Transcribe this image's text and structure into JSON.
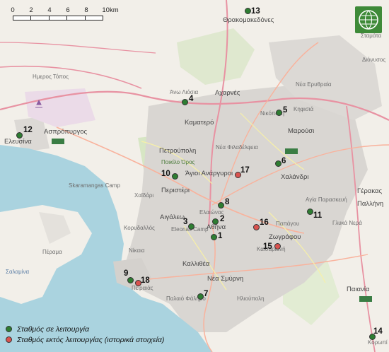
{
  "colors": {
    "active_station": "#2e7d32",
    "inactive_station": "#d9534f",
    "sea": "#aad3df",
    "land": "#f2efe9",
    "urban": "#d6d3d0",
    "motorway": "#e892a2",
    "trunk": "#f9b29c",
    "green_area": "#cde6b8"
  },
  "scale": {
    "ticks": [
      "0",
      "2",
      "4",
      "6",
      "8",
      "10km"
    ]
  },
  "logo": {
    "icon": "meteo-network-logo-icon"
  },
  "legend": {
    "items": [
      {
        "label": "Σταθμός σε λειτουργία",
        "color": "#2e7d32"
      },
      {
        "label": "Σταθμός εκτός λειτουργίας (ιστορικά στοιχεία)",
        "color": "#d9534f"
      }
    ]
  },
  "stations": {
    "s1": {
      "num": "1",
      "status": "active"
    },
    "s2": {
      "num": "2",
      "status": "active"
    },
    "s3": {
      "num": "3",
      "status": "active"
    },
    "s4": {
      "num": "4",
      "status": "active"
    },
    "s5": {
      "num": "5",
      "status": "active"
    },
    "s6": {
      "num": "6",
      "status": "active"
    },
    "s7": {
      "num": "7",
      "status": "active"
    },
    "s8": {
      "num": "8",
      "status": "active"
    },
    "s9": {
      "num": "9",
      "status": "active"
    },
    "s10": {
      "num": "10",
      "status": "active"
    },
    "s11": {
      "num": "11",
      "status": "active"
    },
    "s12": {
      "num": "12",
      "status": "active"
    },
    "s13": {
      "num": "13",
      "status": "active"
    },
    "s14": {
      "num": "14",
      "status": "active"
    },
    "s15": {
      "num": "15",
      "status": "inactive"
    },
    "s16": {
      "num": "16",
      "status": "inactive"
    },
    "s17": {
      "num": "17",
      "status": "inactive"
    },
    "s18": {
      "num": "18",
      "status": "inactive"
    }
  },
  "places": {
    "thrakomakedones": "Θρακομακεδόνες",
    "stamata": "Σταμάτα",
    "dionysos": "Διόνυσος",
    "ymittos_topos": "Ημερος Τόπος",
    "ano_liosia": "Άνω Λιόσια",
    "acharnes": "Αχαρνές",
    "kamatero": "Καματερό",
    "aspropyrgos": "Ασπρόπυργος",
    "elefsina": "Ελευσίνα",
    "nea_erythraia": "Νέα Ερυθραία",
    "kifisia": "Κηφισιά",
    "nikopoli": "Νικόπολη",
    "marousi": "Μαρούσι",
    "petroupoli": "Πετρούπολη",
    "poikilo_oros": "Ποικίλο Όρος",
    "agioi_anargyroi": "Άγιοι Ανάργυροι",
    "peristeri": "Περιστέρι",
    "nea_filadelfeia": "Νέα Φιλαδέλφεια",
    "chalandri": "Χαλάνδρι",
    "gerakas": "Γέρακας",
    "pallini": "Παλλήνη",
    "agia_paraskevi": "Αγία Παρασκευή",
    "skaramangas": "Skaramangas Camp",
    "kaidari": "Χαϊδάρι",
    "aigaleo": "Αιγάλεω",
    "eleonas": "Eleonas Camp",
    "athina": "Αθήνα",
    "zografou": "Ζωγράφου",
    "papagou": "Παπάγου",
    "glyka_nera": "Γλυκά Νερά",
    "perama": "Πέραμα",
    "salamina": "Σαλαμίνα",
    "korydallos": "Κορυδαλλός",
    "nikaia": "Νίκαια",
    "kallithea": "Καλλιθέα",
    "nea_smyrni": "Νέα Σμύρνη",
    "palaio_faliro": "Παλαιό Φάληρο",
    "kaisariani": "Καισαριανή",
    "ilioupoli": "Ηλιούπολη",
    "paiania": "Παιανία",
    "koropi": "Κορωπί",
    "pireas": "Πειραιάς",
    "elaionas": "Ελαιώνας"
  }
}
